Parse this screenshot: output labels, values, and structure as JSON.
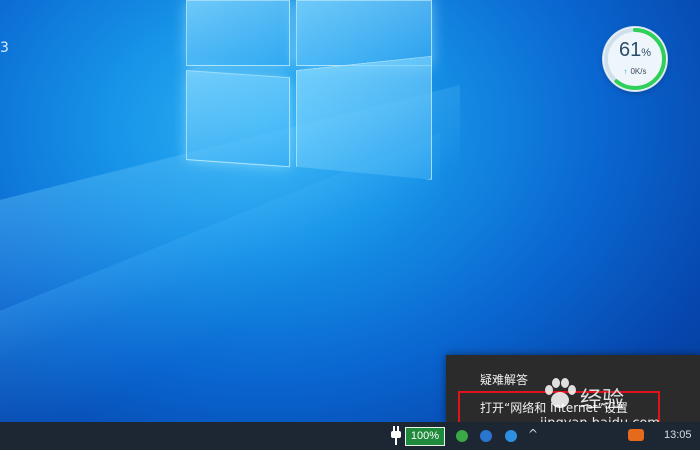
{
  "desktop": {
    "left_edge_text": "3"
  },
  "speed_widget": {
    "percent": "61",
    "percent_unit": "%",
    "upload_rate": "0K/s",
    "progress_fraction": 0.61,
    "ring_color": "#2fcf5a"
  },
  "context_menu": {
    "items": [
      {
        "label": "疑难解答"
      },
      {
        "label": "打开“网络和 Internet”设置"
      }
    ],
    "highlight_color": "#e0121b"
  },
  "taskbar": {
    "battery_percent": "100%",
    "battery_color": "#1f8a3c",
    "clock_partial": "13:05"
  },
  "watermark": {
    "brand": "经验",
    "url": "jingyan.baidu.com"
  }
}
